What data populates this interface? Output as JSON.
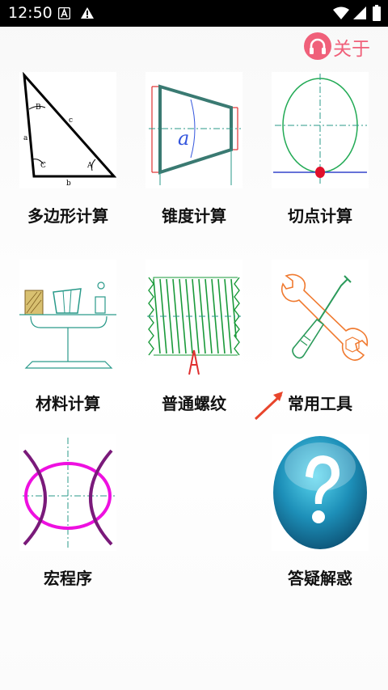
{
  "status_bar": {
    "time": "12:50",
    "icons": [
      "notification-a-icon",
      "warning-icon",
      "wifi-icon",
      "signal-icon",
      "battery-icon"
    ]
  },
  "header": {
    "about_label": "关于",
    "about_color": "#f0607a"
  },
  "tiles": [
    {
      "label": "多边形计算",
      "icon": "triangle-diagram-icon"
    },
    {
      "label": "锥度计算",
      "icon": "taper-diagram-icon"
    },
    {
      "label": "切点计算",
      "icon": "tangent-point-diagram-icon"
    },
    {
      "label": "材料计算",
      "icon": "material-scale-icon"
    },
    {
      "label": "普通螺纹",
      "icon": "thread-diagram-icon"
    },
    {
      "label": "常用工具",
      "icon": "wrench-screwdriver-icon"
    },
    {
      "label": "宏程序",
      "icon": "macro-curve-diagram-icon"
    },
    {
      "label": "答疑解惑",
      "icon": "question-mark-icon"
    }
  ],
  "annotation": {
    "arrow_color": "#e8452c"
  }
}
